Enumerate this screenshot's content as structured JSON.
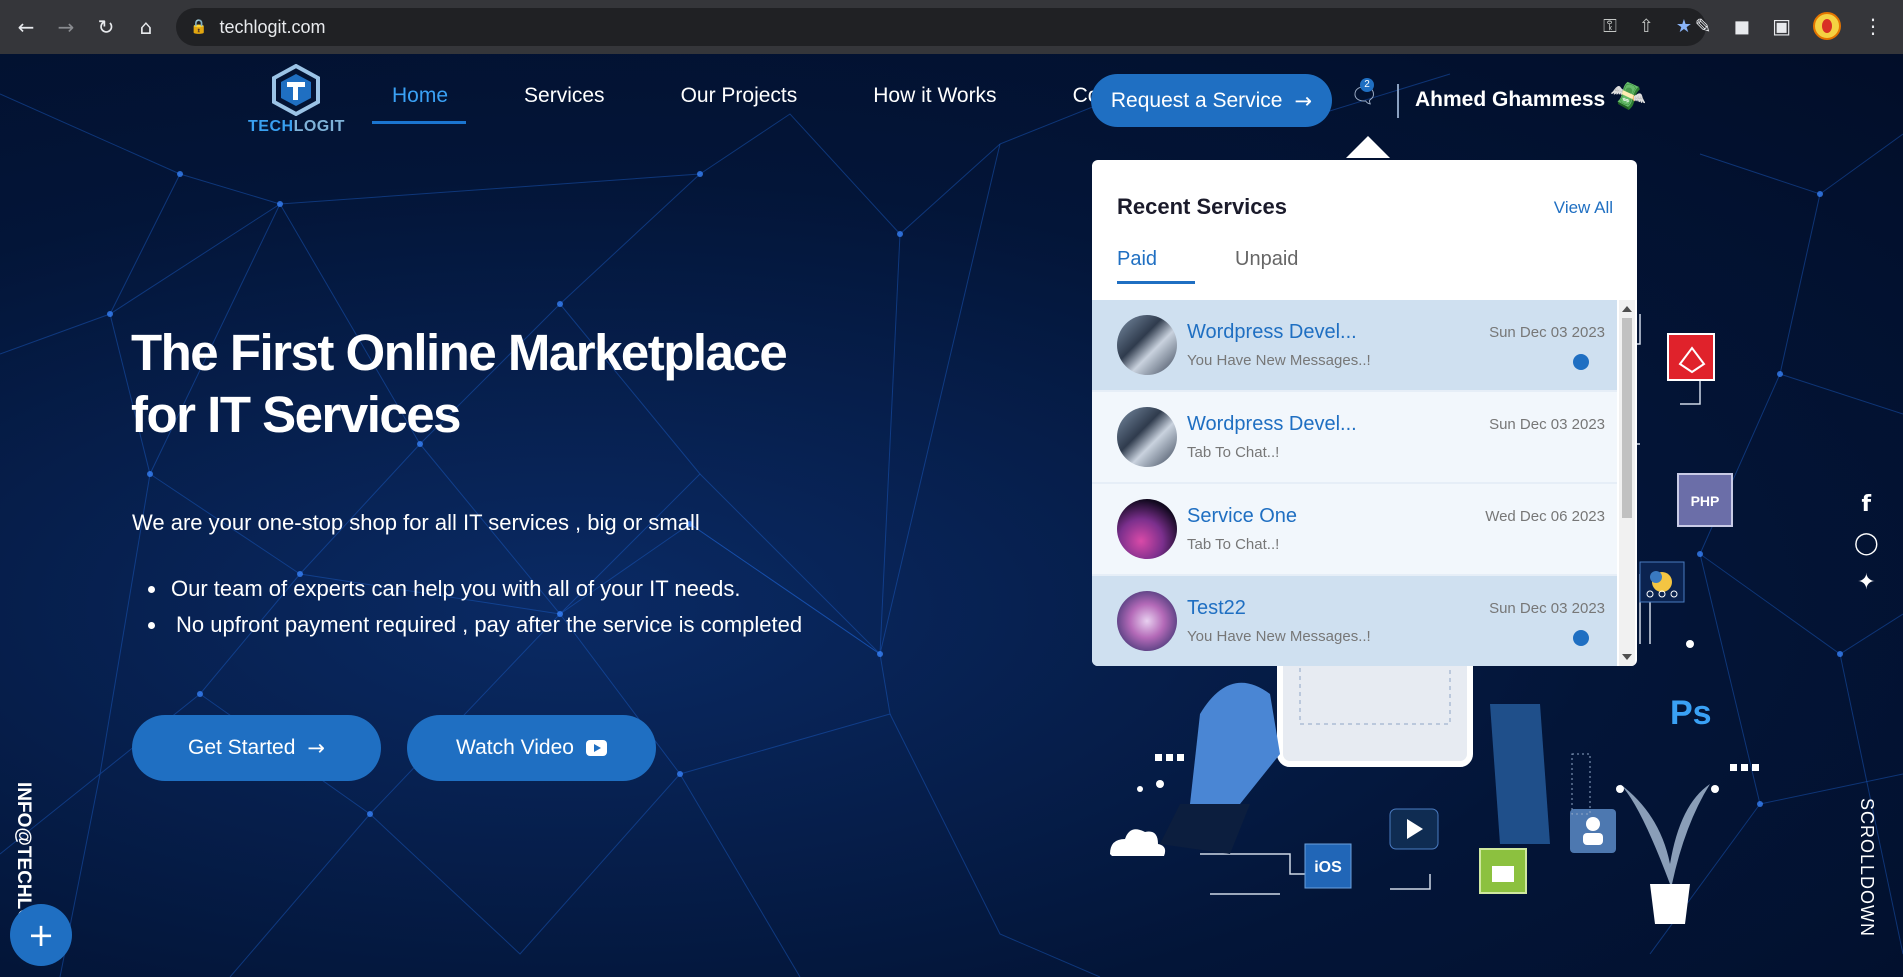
{
  "browser": {
    "url": "techlogit.com",
    "icons": [
      "back-icon",
      "forward-icon",
      "reload-icon",
      "home-icon",
      "lock-icon",
      "key-icon",
      "share-icon",
      "star-icon",
      "extension-icon",
      "puzzle-icon",
      "sidepanel-icon",
      "profile-icon"
    ]
  },
  "logo": {
    "part1": "TECH",
    "part2": "LOGIT"
  },
  "nav": {
    "items": [
      "Home",
      "Services",
      "Our Projects",
      "How it Works",
      "Contact Us"
    ],
    "active": "Home"
  },
  "header": {
    "request_button": "Request a Service",
    "message_badge": "2",
    "user_name": "Ahmed Ghammess"
  },
  "hero": {
    "title_line1": "The First Online Marketplace",
    "title_line2": "for IT Services",
    "subtitle": "We are your one-stop shop for all IT services , big or small",
    "bullets": [
      "Our team of experts can help you with all of your IT needs.",
      "No upfront payment required , pay after the service is completed"
    ],
    "get_started": "Get Started",
    "watch_video": "Watch Video"
  },
  "side": {
    "email": "INFO@TECHLO",
    "scroll": "SCROLLDOWN",
    "social": [
      "facebook-icon",
      "instagram-icon",
      "twitter-icon"
    ]
  },
  "illustration": {
    "labels": {
      "php": "PHP",
      "ps": "Ps",
      "ios": "iOS"
    }
  },
  "dropdown": {
    "title": "Recent Services",
    "view_all": "View All",
    "tabs": [
      "Paid",
      "Unpaid"
    ],
    "active_tab": "Paid",
    "items": [
      {
        "name": "Wordpress Devel...",
        "sub": "You Have New Messages..!",
        "date": "Sun Dec 03 2023",
        "unread": true
      },
      {
        "name": "Wordpress Devel...",
        "sub": "Tab To Chat..!",
        "date": "Sun Dec 03 2023",
        "unread": false
      },
      {
        "name": "Service One",
        "sub": "Tab To Chat..!",
        "date": "Wed Dec 06 2023",
        "unread": false
      },
      {
        "name": "Test22",
        "sub": "You Have New Messages..!",
        "date": "Sun Dec 03 2023",
        "unread": true
      }
    ]
  },
  "colors": {
    "accent": "#1f6fc2",
    "background": "#031538"
  }
}
